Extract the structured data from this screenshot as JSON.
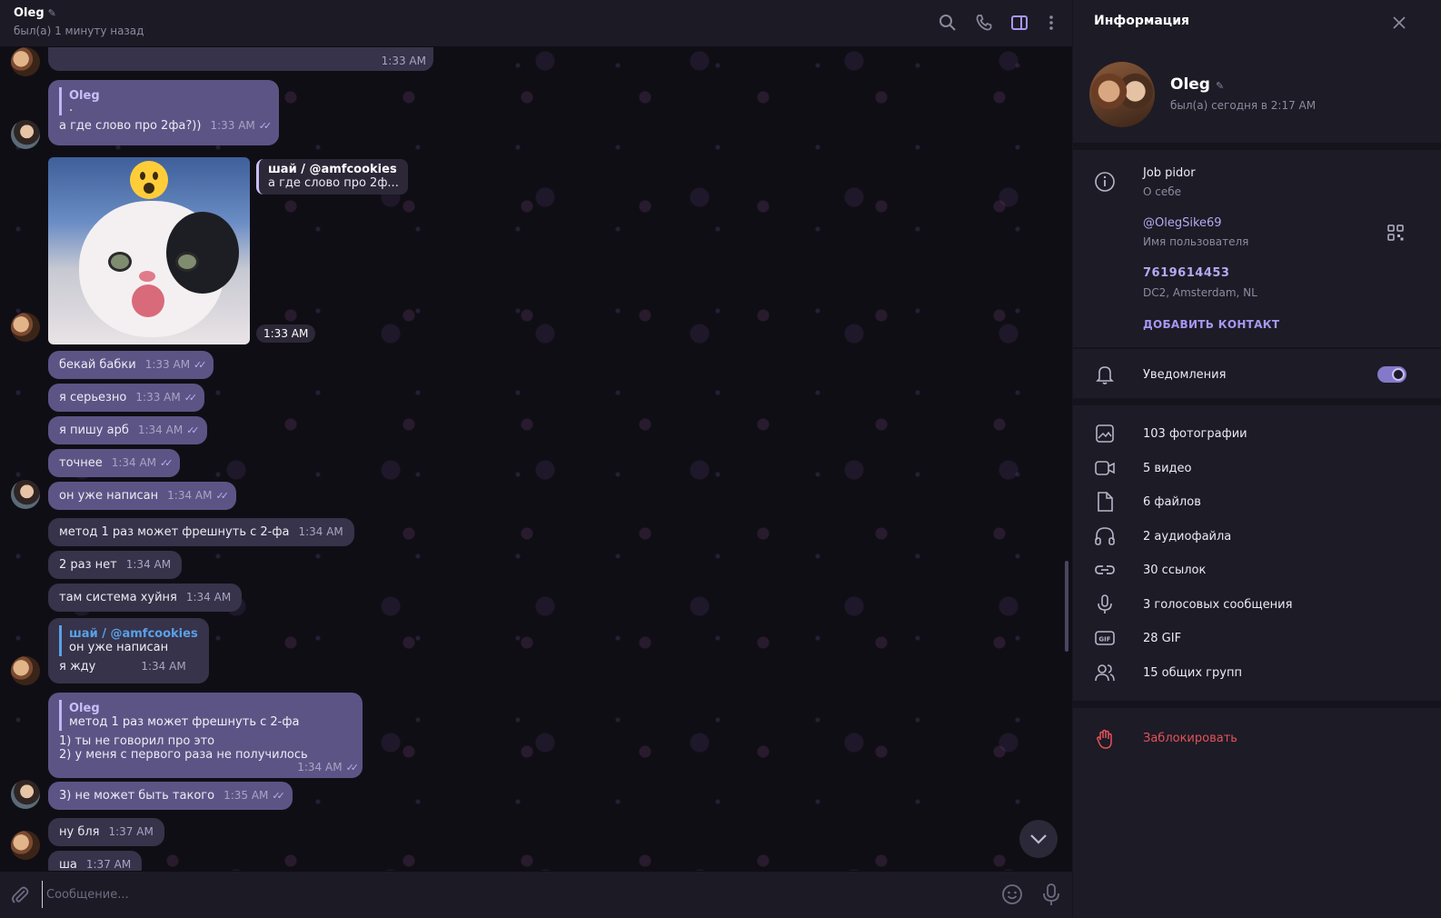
{
  "chat": {
    "title": "Oleg",
    "status": "был(а) 1 минуту назад",
    "input_placeholder": "Сообщение..."
  },
  "messages": {
    "top_strip_time": "1:33 AM",
    "m1": {
      "reply_name": "Oleg",
      "reply_text": ".",
      "text": "а где слово про 2фа?))",
      "time": "1:33 AM"
    },
    "sticker": {
      "reply_name": "шай / @amfcookies",
      "reply_text": "а где слово про 2ф...",
      "time": "1:33 AM"
    },
    "m2": {
      "text": "бекай бабки",
      "time": "1:33 AM"
    },
    "m3": {
      "text": "я серьезно",
      "time": "1:33 AM"
    },
    "m4": {
      "text": "я пишу арб",
      "time": "1:34 AM"
    },
    "m5": {
      "text": "точнее",
      "time": "1:34 AM"
    },
    "m6": {
      "text": "он уже написан",
      "time": "1:34 AM"
    },
    "m7": {
      "text": "метод 1 раз может фрешнуть с 2-фа",
      "time": "1:34 AM"
    },
    "m8": {
      "text": "2 раз нет",
      "time": "1:34 AM"
    },
    "m9": {
      "text": "там система хуйня",
      "time": "1:34 AM"
    },
    "m10": {
      "reply_name": "шай / @amfcookies",
      "reply_text": "он уже написан",
      "text": "я жду",
      "time": "1:34 AM"
    },
    "m11": {
      "reply_name": "Oleg",
      "reply_text": "метод 1 раз может фрешнуть с 2-фа",
      "line1": "1) ты не говорил про это",
      "line2": "2) у меня с первого раза не получилось",
      "time": "1:34 AM"
    },
    "m12": {
      "text": "3) не может быть такого",
      "time": "1:35 AM"
    },
    "m13": {
      "text": "ну бля",
      "time": "1:37 AM"
    },
    "m14": {
      "text": "ша",
      "time": "1:37 AM"
    }
  },
  "info": {
    "title": "Информация",
    "name": "Oleg",
    "status": "был(а) сегодня в 2:17 AM",
    "bio": "Job pidor",
    "bio_label": "О себе",
    "username": "@OlegSike69",
    "username_label": "Имя пользователя",
    "user_id": "7619614453",
    "dc": "DC2, Amsterdam, NL",
    "add_contact": "ДОБАВИТЬ КОНТАКТ",
    "notifications": "Уведомления",
    "notifications_on": true,
    "media": [
      {
        "label": "103 фотографии",
        "icon": "photo-icon"
      },
      {
        "label": "5 видео",
        "icon": "video-icon"
      },
      {
        "label": "6 файлов",
        "icon": "file-icon"
      },
      {
        "label": "2 аудиофайла",
        "icon": "headphones-icon"
      },
      {
        "label": "30 ссылок",
        "icon": "link-icon"
      },
      {
        "label": "3 голосовых сообщения",
        "icon": "mic-icon"
      },
      {
        "label": "28 GIF",
        "icon": "gif-icon"
      },
      {
        "label": "15 общих групп",
        "icon": "groups-icon"
      }
    ],
    "block": "Заблокировать"
  },
  "colors": {
    "accent": "#8478c8",
    "own_bubble": "#5d5486",
    "other_bubble": "#36334a",
    "danger": "#e2535a"
  }
}
